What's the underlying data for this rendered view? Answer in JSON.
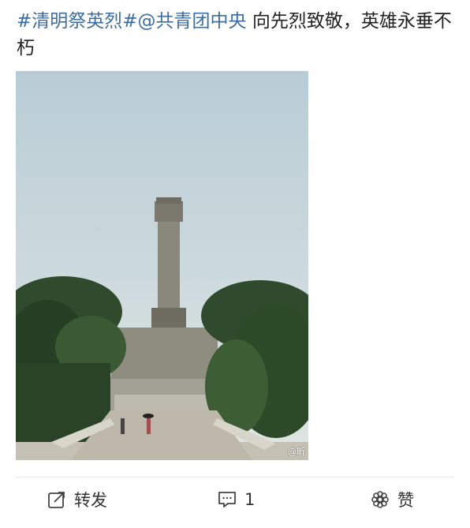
{
  "post": {
    "hashtag_1": "#清明祭英烈#",
    "hashtag_2": "@共青团中央",
    "body": " 向先烈致敬，英雄永垂不朽"
  },
  "image": {
    "alt_icon": "landmark-photo",
    "watermark": "@昕"
  },
  "actions": {
    "repost_label": "转发",
    "comment_count": "1",
    "like_label": "赞"
  },
  "icons": {
    "repost": "repost-icon",
    "comment": "comment-icon",
    "like": "like-icon"
  },
  "colors": {
    "hashtag": "#3d6da0",
    "text": "#222222",
    "action_text": "#333333"
  }
}
